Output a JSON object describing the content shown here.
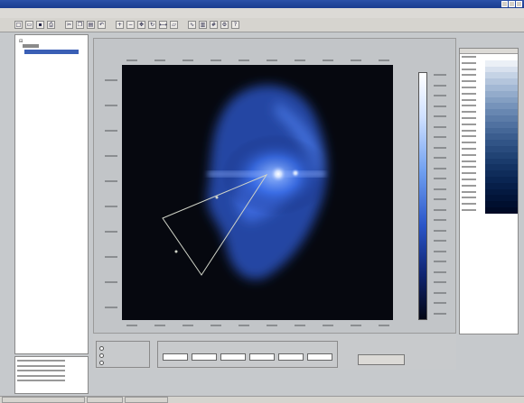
{
  "window": {
    "title": ""
  },
  "menu": [],
  "log_lines": [
    "",
    "",
    "",
    "",
    ""
  ],
  "colors": {
    "image_background": "#06080f",
    "colorbar_top": "#ffffff",
    "colorbar_bottom": "#030714",
    "beam_glow": "#5f8df5",
    "selection_box": "#d0d4c8",
    "tree_selection": "#3a5fb5"
  },
  "icons": {
    "toolbar": [
      "new-icon",
      "open-icon",
      "save-icon",
      "print-icon",
      "cut-icon",
      "copy-icon",
      "paste-icon",
      "undo-icon",
      "zoom-in-icon",
      "zoom-out-icon",
      "pan-icon",
      "rotate-icon",
      "measure-icon",
      "region-icon",
      "profile-icon",
      "histogram-icon",
      "grid-icon",
      "settings-icon",
      "help-icon"
    ]
  },
  "right_list": {
    "row_count": 26
  }
}
